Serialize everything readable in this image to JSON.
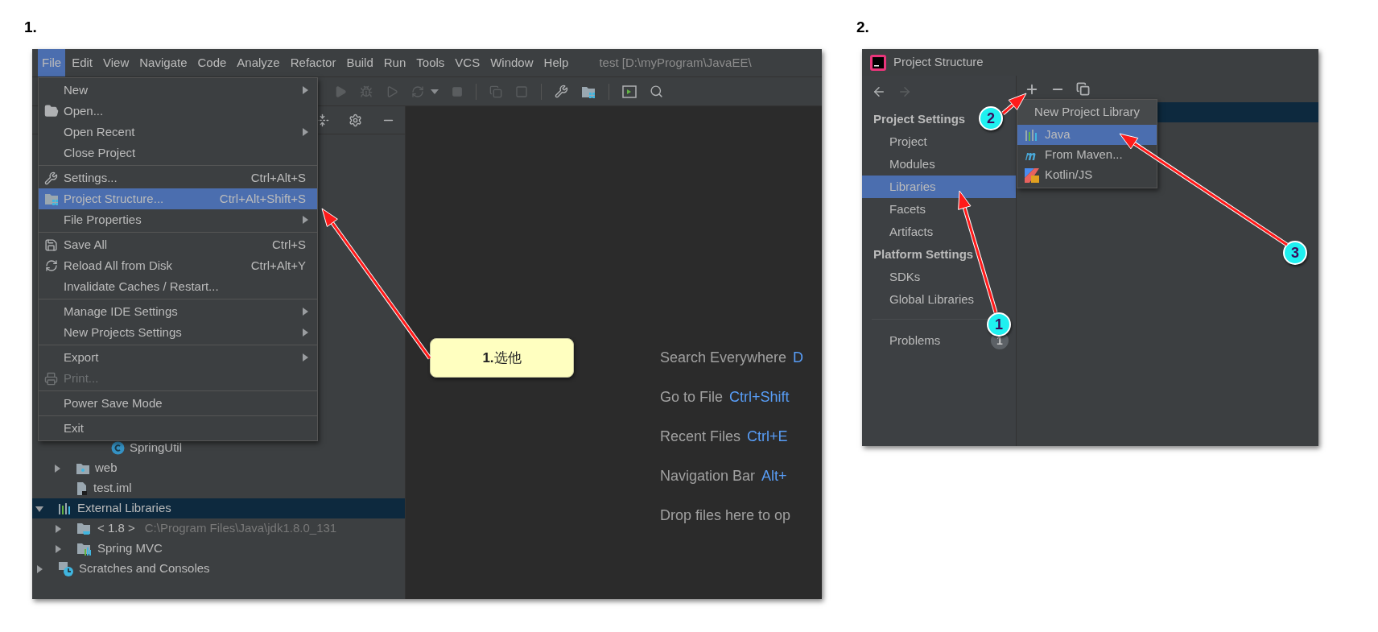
{
  "step1": {
    "number": "1.",
    "menu_bar": {
      "items": [
        {
          "label": "File",
          "selected": true
        },
        {
          "label": "Edit",
          "selected": false
        },
        {
          "label": "View",
          "selected": false
        },
        {
          "label": "Navigate",
          "selected": false
        },
        {
          "label": "Code",
          "selected": false
        },
        {
          "label": "Analyze",
          "selected": false
        },
        {
          "label": "Refactor",
          "selected": false
        },
        {
          "label": "Build",
          "selected": false
        },
        {
          "label": "Run",
          "selected": false
        },
        {
          "label": "Tools",
          "selected": false
        },
        {
          "label": "VCS",
          "selected": false
        },
        {
          "label": "Window",
          "selected": false
        },
        {
          "label": "Help",
          "selected": false
        }
      ],
      "title": "test [D:\\myProgram\\JavaEE\\"
    },
    "file_menu": [
      {
        "kind": "item",
        "label": "New",
        "submenu": true,
        "selected": false,
        "disabled": false
      },
      {
        "kind": "item",
        "label": "Open...",
        "submenu": false,
        "selected": false,
        "disabled": false
      },
      {
        "kind": "item",
        "label": "Open Recent",
        "submenu": true,
        "selected": false,
        "disabled": false
      },
      {
        "kind": "item",
        "label": "Close Project",
        "submenu": false,
        "selected": false,
        "disabled": false
      },
      {
        "kind": "separator"
      },
      {
        "kind": "item",
        "label": "Settings...",
        "shortcut": "Ctrl+Alt+S",
        "submenu": false,
        "selected": false,
        "disabled": false
      },
      {
        "kind": "item",
        "label": "Project Structure...",
        "shortcut": "Ctrl+Alt+Shift+S",
        "submenu": false,
        "selected": true,
        "disabled": false
      },
      {
        "kind": "item",
        "label": "File Properties",
        "submenu": true,
        "selected": false,
        "disabled": false
      },
      {
        "kind": "separator"
      },
      {
        "kind": "item",
        "label": "Save All",
        "shortcut": "Ctrl+S",
        "submenu": false,
        "selected": false,
        "disabled": false
      },
      {
        "kind": "item",
        "label": "Reload All from Disk",
        "shortcut": "Ctrl+Alt+Y",
        "submenu": false,
        "selected": false,
        "disabled": false
      },
      {
        "kind": "item",
        "label": "Invalidate Caches / Restart...",
        "submenu": false,
        "selected": false,
        "disabled": false
      },
      {
        "kind": "separator"
      },
      {
        "kind": "item",
        "label": "Manage IDE Settings",
        "submenu": true,
        "selected": false,
        "disabled": false
      },
      {
        "kind": "item",
        "label": "New Projects Settings",
        "submenu": true,
        "selected": false,
        "disabled": false
      },
      {
        "kind": "separator"
      },
      {
        "kind": "item",
        "label": "Export",
        "submenu": true,
        "selected": false,
        "disabled": false
      },
      {
        "kind": "item",
        "label": "Print...",
        "submenu": false,
        "selected": false,
        "disabled": true
      },
      {
        "kind": "separator"
      },
      {
        "kind": "item",
        "label": "Power Save Mode",
        "submenu": false,
        "selected": false,
        "disabled": false
      },
      {
        "kind": "separator"
      },
      {
        "kind": "item",
        "label": "Exit",
        "submenu": false,
        "selected": false,
        "disabled": false
      }
    ],
    "project_tree": [
      {
        "kind": "class",
        "label": "SpringUtil",
        "selected": false
      },
      {
        "kind": "folder",
        "label": "web",
        "selected": false,
        "expanded": false
      },
      {
        "kind": "file",
        "label": "test.iml",
        "selected": false
      },
      {
        "kind": "library-root",
        "label": "External Libraries",
        "selected": true,
        "expanded": true,
        "children": [
          {
            "kind": "sdk",
            "label": "< 1.8 >",
            "path": "C:\\Program Files\\Java\\jdk1.8.0_131",
            "selected": false,
            "expanded": false
          },
          {
            "kind": "library",
            "label": "Spring MVC",
            "selected": false,
            "expanded": false
          }
        ]
      },
      {
        "kind": "scratches",
        "label": "Scratches and Consoles",
        "selected": false,
        "expanded": false
      }
    ],
    "welcome_hints": [
      {
        "label": "Search Everywhere",
        "shortcut": "D"
      },
      {
        "label": "Go to File",
        "shortcut": "Ctrl+Shift"
      },
      {
        "label": "Recent Files",
        "shortcut": "Ctrl+E"
      },
      {
        "label": "Navigation Bar",
        "shortcut": "Alt+"
      },
      {
        "label": "Drop files here to op"
      }
    ],
    "callout": "**1.**选他"
  },
  "step2": {
    "number": "2.",
    "title": "Project Structure",
    "sidebar": {
      "sections": [
        {
          "heading": "Project Settings",
          "items": [
            {
              "label": "Project",
              "selected": false
            },
            {
              "label": "Modules",
              "selected": false
            },
            {
              "label": "Libraries",
              "selected": true
            },
            {
              "label": "Facets",
              "selected": false
            },
            {
              "label": "Artifacts",
              "selected": false
            }
          ]
        },
        {
          "heading": "Platform Settings",
          "items": [
            {
              "label": "SDKs",
              "selected": false
            },
            {
              "label": "Global Libraries",
              "selected": false
            }
          ]
        }
      ],
      "problems": {
        "label": "Problems",
        "count": "1"
      }
    },
    "popup": {
      "header": "New Project Library",
      "items": [
        {
          "label": "Java",
          "selected": true
        },
        {
          "label": "From Maven...",
          "selected": false
        },
        {
          "label": "Kotlin/JS",
          "selected": false
        }
      ]
    },
    "markers": [
      {
        "number": "1"
      },
      {
        "number": "2"
      },
      {
        "number": "3"
      }
    ]
  }
}
